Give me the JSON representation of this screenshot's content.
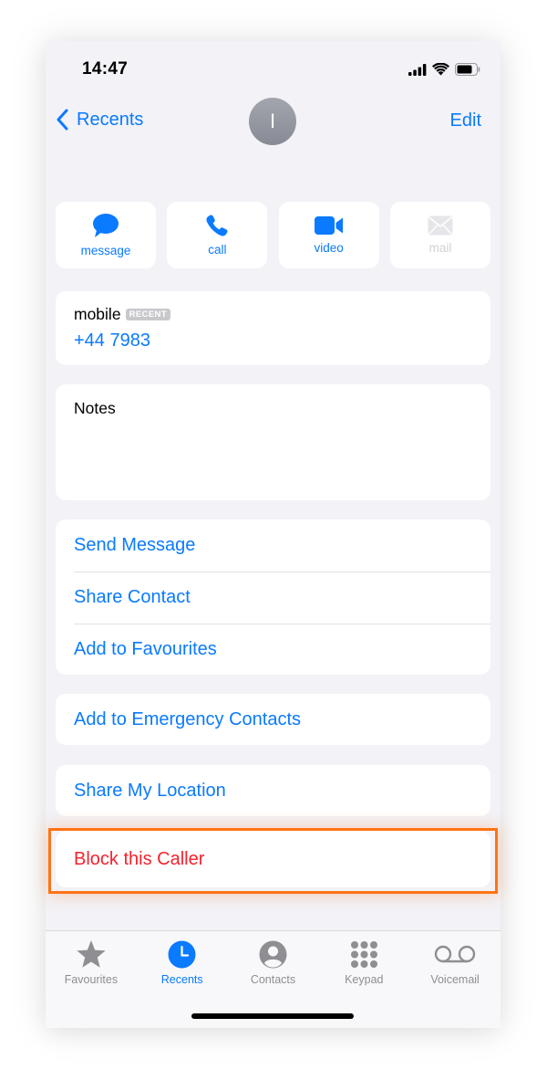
{
  "status_bar": {
    "time": "14:47",
    "icons": [
      "cellular-signal-icon",
      "wifi-icon",
      "battery-icon"
    ]
  },
  "nav": {
    "back_label": "Recents",
    "edit_label": "Edit",
    "avatar_initial": "I"
  },
  "quick_actions": [
    {
      "label": "message",
      "icon": "message-bubble-icon",
      "enabled": true
    },
    {
      "label": "call",
      "icon": "phone-icon",
      "enabled": true
    },
    {
      "label": "video",
      "icon": "video-camera-icon",
      "enabled": true
    },
    {
      "label": "mail",
      "icon": "envelope-icon",
      "enabled": false
    }
  ],
  "phone": {
    "label": "mobile",
    "badge": "RECENT",
    "number": "+44 7983"
  },
  "notes": {
    "label": "Notes",
    "value": ""
  },
  "action_group": [
    {
      "label": "Send Message"
    },
    {
      "label": "Share Contact"
    },
    {
      "label": "Add to Favourites"
    }
  ],
  "emergency": {
    "label": "Add to Emergency Contacts"
  },
  "location": {
    "label": "Share My Location"
  },
  "block": {
    "label": "Block this Caller",
    "highlighted": true
  },
  "tab_bar": {
    "active": "Recents",
    "tabs": [
      {
        "label": "Favourites",
        "icon": "star-icon"
      },
      {
        "label": "Recents",
        "icon": "clock-icon"
      },
      {
        "label": "Contacts",
        "icon": "person-circle-icon"
      },
      {
        "label": "Keypad",
        "icon": "keypad-icon"
      },
      {
        "label": "Voicemail",
        "icon": "voicemail-icon"
      }
    ]
  },
  "colors": {
    "accent": "#0a7aff",
    "destructive": "#f5222d",
    "highlight_border": "#ff7313",
    "background": "#f2f2f7"
  }
}
